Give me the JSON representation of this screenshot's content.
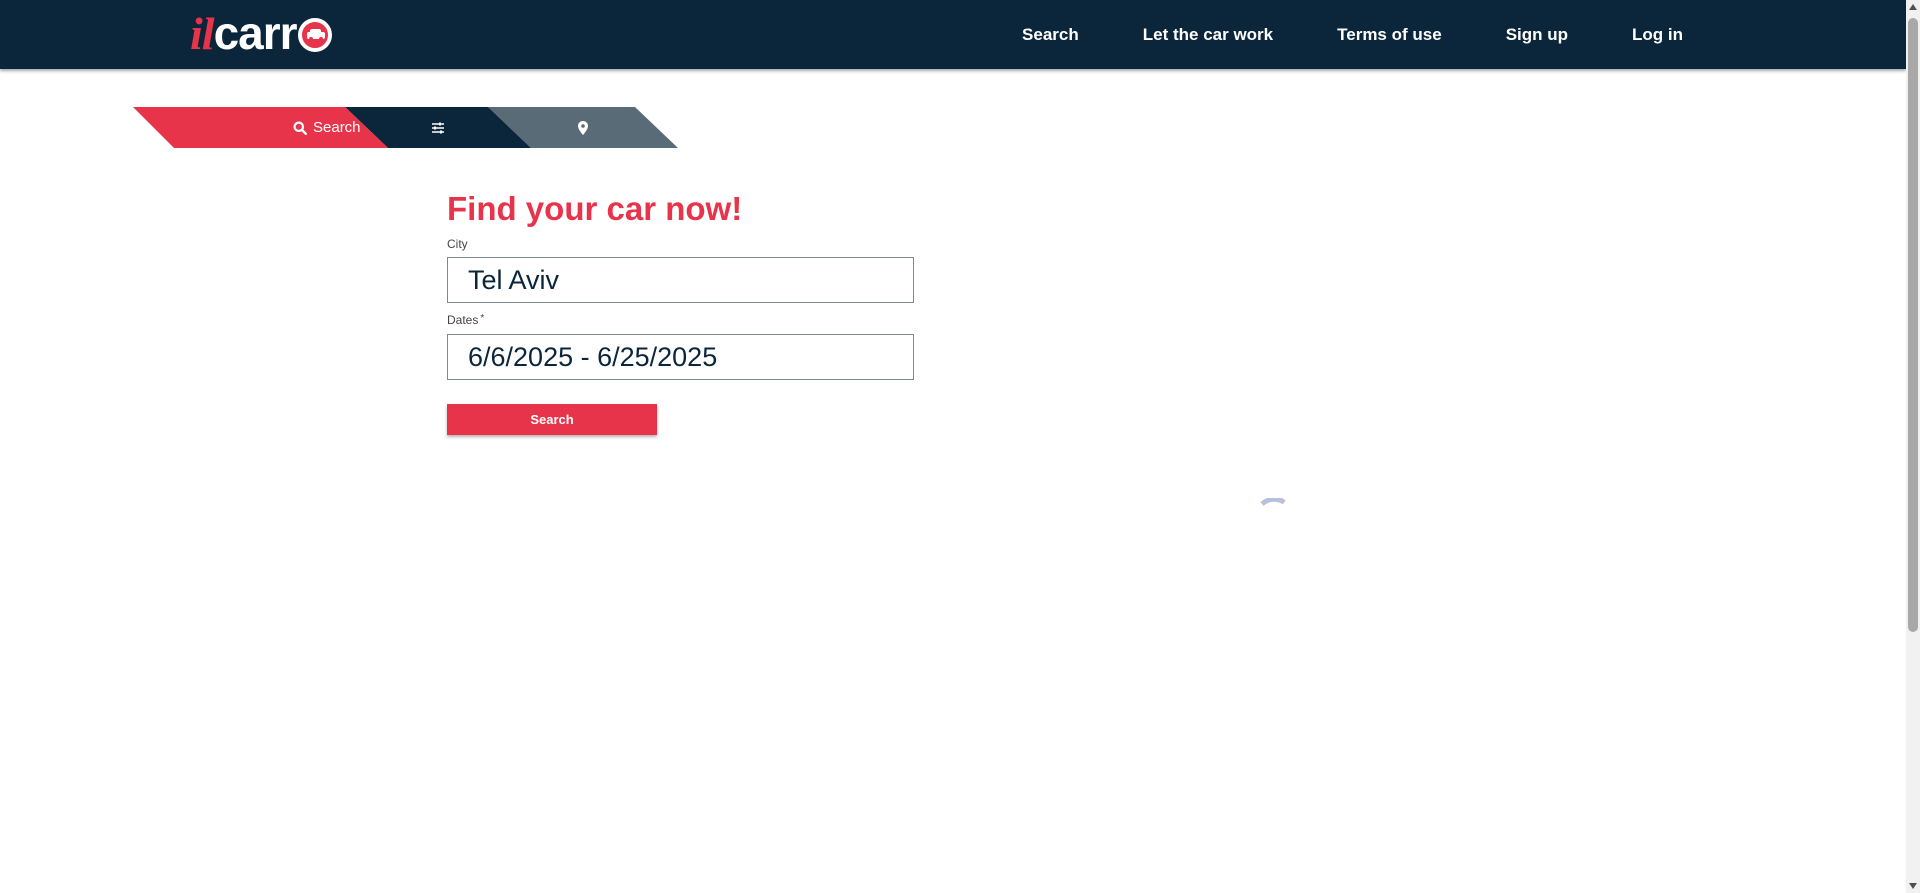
{
  "header": {
    "logo": {
      "part1": "il",
      "part2": "carr"
    },
    "nav": [
      {
        "label": "Search"
      },
      {
        "label": "Let the car work"
      },
      {
        "label": "Terms of use"
      },
      {
        "label": "Sign up"
      },
      {
        "label": "Log in"
      }
    ]
  },
  "tabs": {
    "search": {
      "label": "Search",
      "icon": "search-icon"
    },
    "filter": {
      "icon": "sliders-icon"
    },
    "map": {
      "icon": "map-pin-icon"
    }
  },
  "form": {
    "title": "Find your car now!",
    "city": {
      "label": "City",
      "value": "Tel Aviv"
    },
    "dates": {
      "label": "Dates",
      "required_mark": "*",
      "value": "6/6/2025 - 6/25/2025"
    },
    "submit_label": "Search"
  },
  "colors": {
    "brand_red": "#e8344a",
    "header_bg": "#0b263b",
    "tab_gray": "#5a6b78",
    "spinner": "#b8bfe0"
  }
}
